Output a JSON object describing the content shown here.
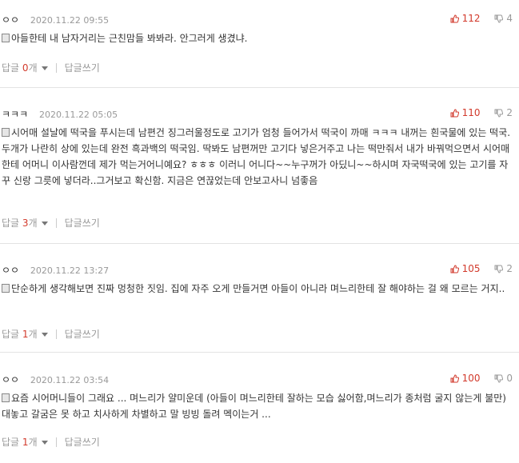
{
  "colors": {
    "accent": "#d23a2c",
    "muted": "#999999"
  },
  "comments": [
    {
      "author": "ㅇㅇ",
      "date": "2020.11.22 09:55",
      "up": "112",
      "down": "4",
      "text": "아들한테 내 남자거리는 근친맘들 봐봐라. 안그러게 생겼냐.",
      "reply_label": "답글",
      "reply_count": "0",
      "reply_unit": "개",
      "write_reply": "답글쓰기"
    },
    {
      "author": "ㅋㅋㅋ",
      "date": "2020.11.22 05:05",
      "up": "110",
      "down": "2",
      "text": "시어매 설날에 떡국을 푸시는데 남편건 징그러울정도로 고기가 엄청 들어가서 떡국이 까매 ㅋㅋㅋ 내꺼는 흰국물에 있는 떡국. 두개가 나란히 상에 있는데 완전 흑과백의 떡국임. 딱봐도 남편꺼만 고기다 넣은거주고 나는 떡만줘서 내가 바꿔먹으면서 시어매한테 어머니 이사람껀데 제가 먹는거어니예요? ㅎㅎㅎ 이러니 어니다~~누구꺼가 아딨니~~하시며 자국떡국에 있는 고기를 자꾸 신랑 그릇에 넣더라..그거보고 확신함. 지금은 연끊었는데 안보고사니 넘좋음",
      "reply_label": "답글",
      "reply_count": "3",
      "reply_unit": "개",
      "write_reply": "답글쓰기"
    },
    {
      "author": "ㅇㅇ",
      "date": "2020.11.22 13:27",
      "up": "105",
      "down": "2",
      "text": "단순하게 생각해보면 진짜 멍청한 짓임. 집에 자주 오게 만들거면 아들이 아니라 며느리한테 잘 해야하는 걸 왜 모르는 거지..",
      "reply_label": "답글",
      "reply_count": "1",
      "reply_unit": "개",
      "write_reply": "답글쓰기"
    },
    {
      "author": "ㅇㅇ",
      "date": "2020.11.22 03:54",
      "up": "100",
      "down": "0",
      "text": "요즘 시어머니들이 그래요 ... 며느리가 얄미운데 (아들이 며느리한테 잘하는 모습 싫어함,며느리가 종처럼 굴지 않는게 불만) 대놓고 갈굼은 못 하고 치사하게 차별하고 말 빙빙 돌려 멕이는거 ...",
      "reply_label": "답글",
      "reply_count": "1",
      "reply_unit": "개",
      "write_reply": "답글쓰기"
    }
  ]
}
